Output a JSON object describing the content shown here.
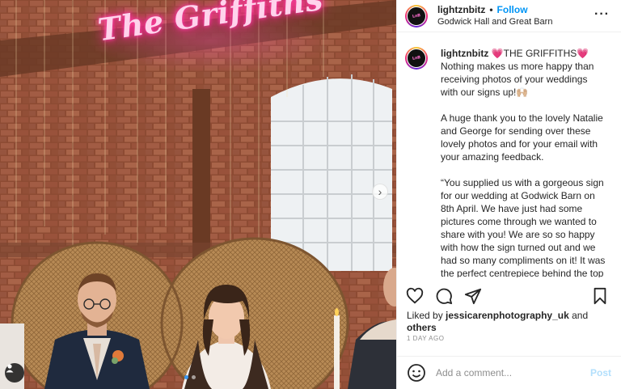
{
  "post": {
    "username": "lightznbitz",
    "follow_label": "Follow",
    "location": "Godwick Hall and Great Barn",
    "neon_sign_text": "The Griffiths",
    "carousel_total": 2,
    "carousel_active": 1
  },
  "caption": {
    "username": "lightznbitz",
    "heading": "💗THE GRIFFITHS💗",
    "line1": "Nothing makes us more happy than receiving photos of your weddings with our signs up!🙌🏼",
    "line2": "A huge thank you to the lovely Natalie and George for sending over these lovely photos and for your email with your amazing feedback.",
    "line3": "“You supplied us with a gorgeous sign for our wedding at Godwick Barn on 8th April. We have just had some pictures come through we wanted to share with you! We are so so happy with how the sign turned out and we had so many compliments on it! It was the perfect centrepiece behind the top table."
  },
  "actions": {
    "like_icon": "heart-icon",
    "comment_icon": "comment-icon",
    "share_icon": "paper-plane-icon",
    "save_icon": "bookmark-icon"
  },
  "likes": {
    "prefix": "Liked by",
    "user": "jessicarenphotography_uk",
    "and": "and",
    "others": "others"
  },
  "timestamp": "1 DAY AGO",
  "comment": {
    "placeholder": "Add a comment...",
    "post_label": "Post"
  },
  "colors": {
    "link_blue": "#0095f6",
    "neon_pink": "#ff2f9b",
    "post_disabled": "#b2dffc"
  }
}
